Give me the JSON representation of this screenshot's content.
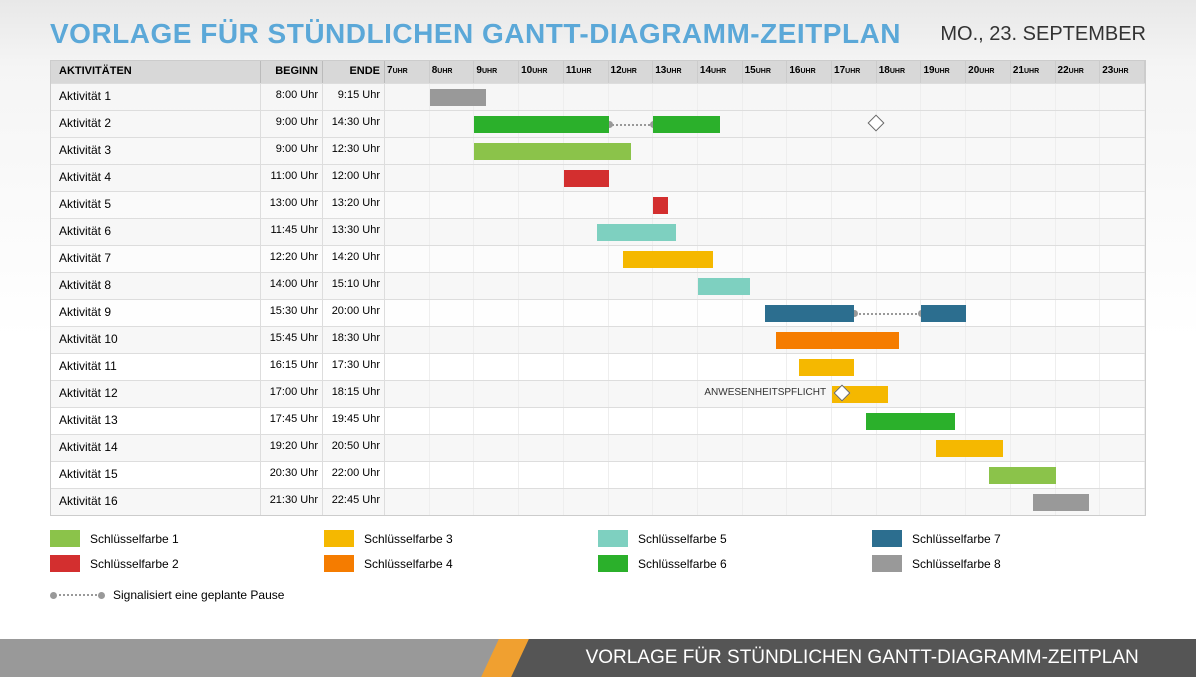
{
  "title": "VORLAGE FÜR STÜNDLICHEN GANTT-DIAGRAMM-ZEITPLAN",
  "date": "MO., 23. SEPTEMBER",
  "headers": {
    "activities": "AKTIVITÄTEN",
    "begin": "BEGINN",
    "end": "ENDE"
  },
  "hourLabel": "UHR",
  "footer": "VORLAGE FÜR STÜNDLICHEN GANTT-DIAGRAMM-ZEITPLAN",
  "pauseLegend": "Signalisiert eine geplante Pause",
  "annotation12": "ANWESENHEITSPFLICHT",
  "chart_data": {
    "type": "gantt",
    "time_range": [
      7,
      24
    ],
    "hours": [
      7,
      8,
      9,
      10,
      11,
      12,
      13,
      14,
      15,
      16,
      17,
      18,
      19,
      20,
      21,
      22,
      23
    ],
    "activities": [
      {
        "name": "Aktivität 1",
        "begin": "8:00 Uhr",
        "end": "9:15 Uhr",
        "segments": [
          {
            "start": 8.0,
            "end": 9.25,
            "color": "#999999"
          }
        ]
      },
      {
        "name": "Aktivität 2",
        "begin": "9:00 Uhr",
        "end": "14:30 Uhr",
        "segments": [
          {
            "start": 9.0,
            "end": 12.0,
            "color": "#2bb02b"
          },
          {
            "start": 13.0,
            "end": 14.5,
            "color": "#2bb02b"
          }
        ],
        "pause": {
          "start": 12.0,
          "end": 13.0
        },
        "diamond": 18.0
      },
      {
        "name": "Aktivität 3",
        "begin": "9:00 Uhr",
        "end": "12:30 Uhr",
        "segments": [
          {
            "start": 9.0,
            "end": 12.5,
            "color": "#8bc34a"
          }
        ]
      },
      {
        "name": "Aktivität 4",
        "begin": "11:00 Uhr",
        "end": "12:00 Uhr",
        "segments": [
          {
            "start": 11.0,
            "end": 12.0,
            "color": "#d32f2f"
          }
        ]
      },
      {
        "name": "Aktivität 5",
        "begin": "13:00 Uhr",
        "end": "13:20 Uhr",
        "segments": [
          {
            "start": 13.0,
            "end": 13.33,
            "color": "#d32f2f"
          }
        ]
      },
      {
        "name": "Aktivität 6",
        "begin": "11:45 Uhr",
        "end": "13:30 Uhr",
        "segments": [
          {
            "start": 11.75,
            "end": 13.5,
            "color": "#7ed0c0"
          }
        ]
      },
      {
        "name": "Aktivität 7",
        "begin": "12:20 Uhr",
        "end": "14:20 Uhr",
        "segments": [
          {
            "start": 12.33,
            "end": 14.33,
            "color": "#f5b800"
          }
        ]
      },
      {
        "name": "Aktivität 8",
        "begin": "14:00 Uhr",
        "end": "15:10 Uhr",
        "segments": [
          {
            "start": 14.0,
            "end": 15.17,
            "color": "#7ed0c0"
          }
        ]
      },
      {
        "name": "Aktivität 9",
        "begin": "15:30 Uhr",
        "end": "20:00 Uhr",
        "segments": [
          {
            "start": 15.5,
            "end": 17.5,
            "color": "#2c6e8f"
          },
          {
            "start": 19.0,
            "end": 20.0,
            "color": "#2c6e8f"
          }
        ],
        "pause": {
          "start": 17.5,
          "end": 19.0
        }
      },
      {
        "name": "Aktivität 10",
        "begin": "15:45 Uhr",
        "end": "18:30 Uhr",
        "segments": [
          {
            "start": 15.75,
            "end": 18.5,
            "color": "#f57c00"
          }
        ]
      },
      {
        "name": "Aktivität 11",
        "begin": "16:15 Uhr",
        "end": "17:30 Uhr",
        "segments": [
          {
            "start": 16.25,
            "end": 17.5,
            "color": "#f5b800"
          }
        ]
      },
      {
        "name": "Aktivität 12",
        "begin": "17:00 Uhr",
        "end": "18:15 Uhr",
        "segments": [
          {
            "start": 17.0,
            "end": 18.25,
            "color": "#f5b800"
          }
        ],
        "annotation": "ANWESENHEITSPFLICHT",
        "diamond": 17.25
      },
      {
        "name": "Aktivität 13",
        "begin": "17:45 Uhr",
        "end": "19:45 Uhr",
        "segments": [
          {
            "start": 17.75,
            "end": 19.75,
            "color": "#2bb02b"
          }
        ]
      },
      {
        "name": "Aktivität 14",
        "begin": "19:20 Uhr",
        "end": "20:50 Uhr",
        "segments": [
          {
            "start": 19.33,
            "end": 20.83,
            "color": "#f5b800"
          }
        ]
      },
      {
        "name": "Aktivität 15",
        "begin": "20:30 Uhr",
        "end": "22:00 Uhr",
        "segments": [
          {
            "start": 20.5,
            "end": 22.0,
            "color": "#8bc34a"
          }
        ]
      },
      {
        "name": "Aktivität 16",
        "begin": "21:30 Uhr",
        "end": "22:45 Uhr",
        "segments": [
          {
            "start": 21.5,
            "end": 22.75,
            "color": "#999999"
          }
        ]
      }
    ],
    "legend": [
      {
        "label": "Schlüsselfarbe 1",
        "color": "#8bc34a"
      },
      {
        "label": "Schlüsselfarbe 2",
        "color": "#d32f2f"
      },
      {
        "label": "Schlüsselfarbe 3",
        "color": "#f5b800"
      },
      {
        "label": "Schlüsselfarbe 4",
        "color": "#f57c00"
      },
      {
        "label": "Schlüsselfarbe 5",
        "color": "#7ed0c0"
      },
      {
        "label": "Schlüsselfarbe 6",
        "color": "#2bb02b"
      },
      {
        "label": "Schlüsselfarbe 7",
        "color": "#2c6e8f"
      },
      {
        "label": "Schlüsselfarbe 8",
        "color": "#999999"
      }
    ]
  }
}
